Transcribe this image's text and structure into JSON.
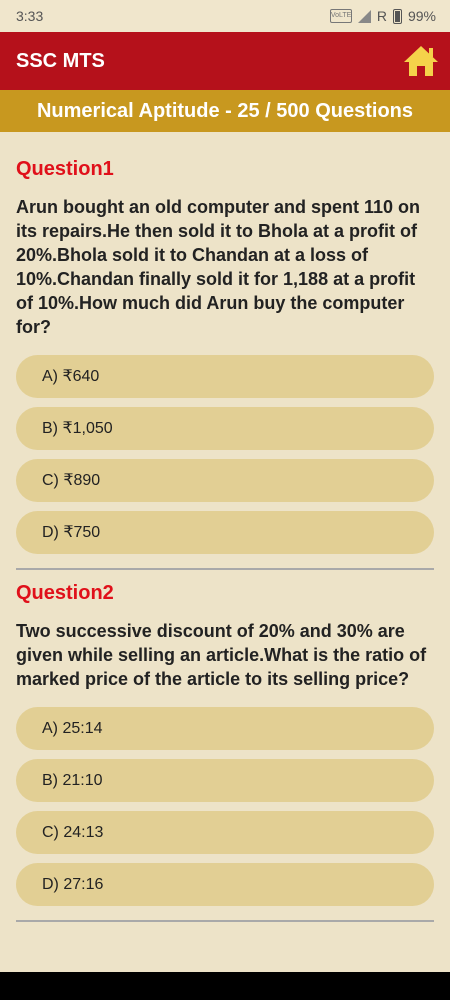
{
  "status": {
    "time": "3:33",
    "volte": "VoLTE",
    "network": "R",
    "battery": "99%"
  },
  "app": {
    "title": "SSC MTS"
  },
  "subheader": {
    "title": "Numerical Aptitude - 25 / 500 Questions"
  },
  "questions": [
    {
      "title": "Question1",
      "text": "Arun bought an old computer and spent 110 on its repairs.He then sold it to Bhola at a profit of 20%.Bhola sold it to Chandan at a loss of 10%.Chandan finally sold it for 1,188 at a profit of 10%.How much did Arun buy the computer for?",
      "options": [
        "A) ₹640",
        "B) ₹1,050",
        "C) ₹890",
        "D) ₹750"
      ]
    },
    {
      "title": "Question2",
      "text": "Two successive discount of 20% and 30% are given while selling an article.What is the ratio of marked price of the article to its selling price?",
      "options": [
        "A) 25:14",
        "B) 21:10",
        "C) 24:13",
        "D) 27:16"
      ]
    }
  ],
  "colors": {
    "app_bar": "#b5111b",
    "subheader": "#c8981f",
    "background": "#ede3c8",
    "option": "#e2cf94",
    "question_title": "#e0101a"
  },
  "icons": [
    "home-icon",
    "volte-icon",
    "signal-icon",
    "battery-icon"
  ]
}
